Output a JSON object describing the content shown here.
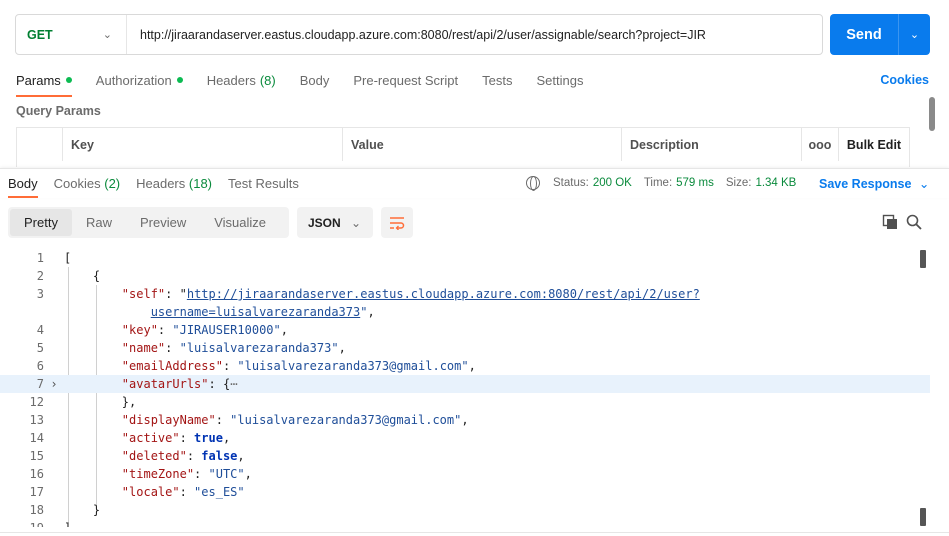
{
  "request": {
    "method": "GET",
    "url": "http://jiraarandaserver.eastus.cloudapp.azure.com:8080/rest/api/2/user/assignable/search?project=JIR",
    "send_label": "Send"
  },
  "request_tabs": {
    "params": "Params",
    "authorization": "Authorization",
    "headers": "Headers",
    "headers_count": "(8)",
    "body": "Body",
    "prerequest": "Pre-request Script",
    "tests": "Tests",
    "settings": "Settings",
    "cookies": "Cookies"
  },
  "query_params": {
    "title": "Query Params",
    "columns": {
      "key": "Key",
      "value": "Value",
      "description": "Description",
      "more": "ooo",
      "bulk_edit": "Bulk Edit"
    }
  },
  "response_tabs": {
    "body": "Body",
    "cookies": "Cookies",
    "cookies_count": "(2)",
    "headers": "Headers",
    "headers_count": "(18)",
    "test_results": "Test Results"
  },
  "response_status": {
    "status_label": "Status:",
    "status_value": "200 OK",
    "time_label": "Time:",
    "time_value": "579 ms",
    "size_label": "Size:",
    "size_value": "1.34 KB",
    "save_response": "Save Response"
  },
  "view_modes": {
    "pretty": "Pretty",
    "raw": "Raw",
    "preview": "Preview",
    "visualize": "Visualize",
    "format": "JSON"
  },
  "code": {
    "line_numbers": [
      "1",
      "2",
      "3",
      "",
      "4",
      "5",
      "6",
      "7",
      "12",
      "13",
      "14",
      "15",
      "16",
      "17",
      "18",
      "19"
    ],
    "self_url_1": "http://jiraarandaserver.eastus.cloudapp.azure.com:8080/rest/api/2/user?",
    "self_url_2": "username=luisalvarezaranda373",
    "key_value": "\"JIRAUSER10000\"",
    "name_value": "\"luisalvarezaranda373\"",
    "email_value": "\"luisalvarezaranda373@gmail.com\"",
    "display_name_value": "\"luisalvarezaranda373@gmail.com\"",
    "active_value": "true",
    "deleted_value": "false",
    "timezone_value": "\"UTC\"",
    "locale_value": "\"es_ES\""
  },
  "icons": {
    "method_chevron": "chevron-down-icon",
    "send_chevron": "chevron-down-icon",
    "globe": "globe-icon",
    "wrap": "wrap-lines-icon",
    "copy": "copy-icon",
    "search": "search-icon",
    "fold": "chevron-right-icon"
  },
  "colors": {
    "accent": "#ff6c37",
    "send_button": "#097bed",
    "status_ok": "#0a8a3c",
    "method_get": "#007f31",
    "highlight_line": "#e8f2fc"
  }
}
